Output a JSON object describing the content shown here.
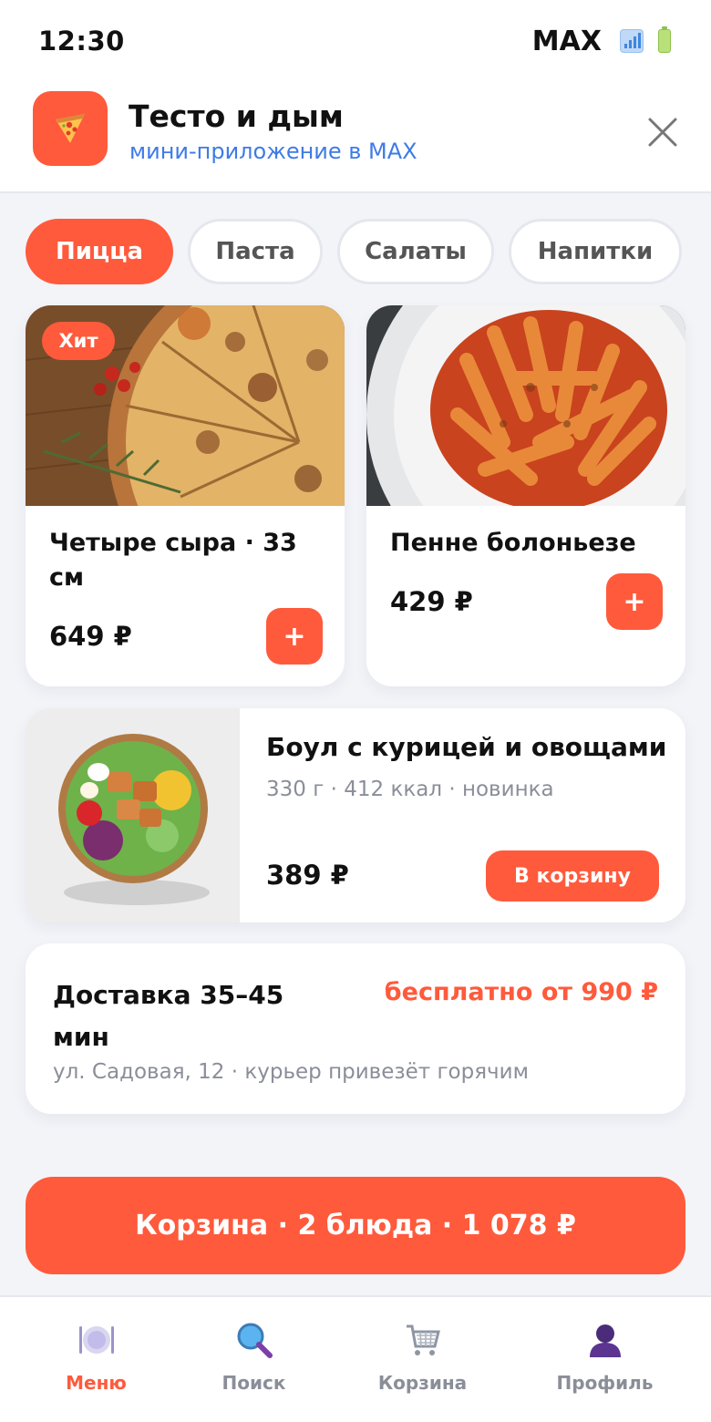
{
  "status_bar": {
    "time": "12:30",
    "carrier": "MAX"
  },
  "header": {
    "title": "Тесто и дым",
    "subtitle": "мини-приложение в MAX"
  },
  "tabs": [
    {
      "label": "Пицца",
      "active": true
    },
    {
      "label": "Паста",
      "active": false
    },
    {
      "label": "Салаты",
      "active": false
    },
    {
      "label": "Напитки",
      "active": false
    }
  ],
  "products": [
    {
      "name_line1": "Четыре сыра · 33",
      "name_line2": "см",
      "price": "649 ₽",
      "badge": "Хит",
      "add_label": "+"
    },
    {
      "name": "Пенне болоньезе",
      "price": "429 ₽",
      "add_label": "+"
    }
  ],
  "featured": {
    "name": "Боул с курицей и овощами",
    "meta": "330 г · 412 ккал · новинка",
    "price": "389 ₽",
    "button": "В корзину"
  },
  "delivery": {
    "title": "Доставка 35–45 мин",
    "free": "бесплатно от 990 ₽",
    "address": "ул. Садовая, 12 · курьер привезёт горячим"
  },
  "cart_button": "Корзина · 2 блюда · 1 078 ₽",
  "nav": [
    {
      "label": "Меню",
      "icon": "plate-icon",
      "active": true
    },
    {
      "label": "Поиск",
      "icon": "search-icon",
      "active": false
    },
    {
      "label": "Корзина",
      "icon": "cart-icon",
      "active": false
    },
    {
      "label": "Профиль",
      "icon": "profile-icon",
      "active": false
    }
  ],
  "colors": {
    "accent": "#FF5A3C",
    "link": "#3E7BE6",
    "background": "#F3F4F8",
    "muted": "#8A8E98"
  }
}
